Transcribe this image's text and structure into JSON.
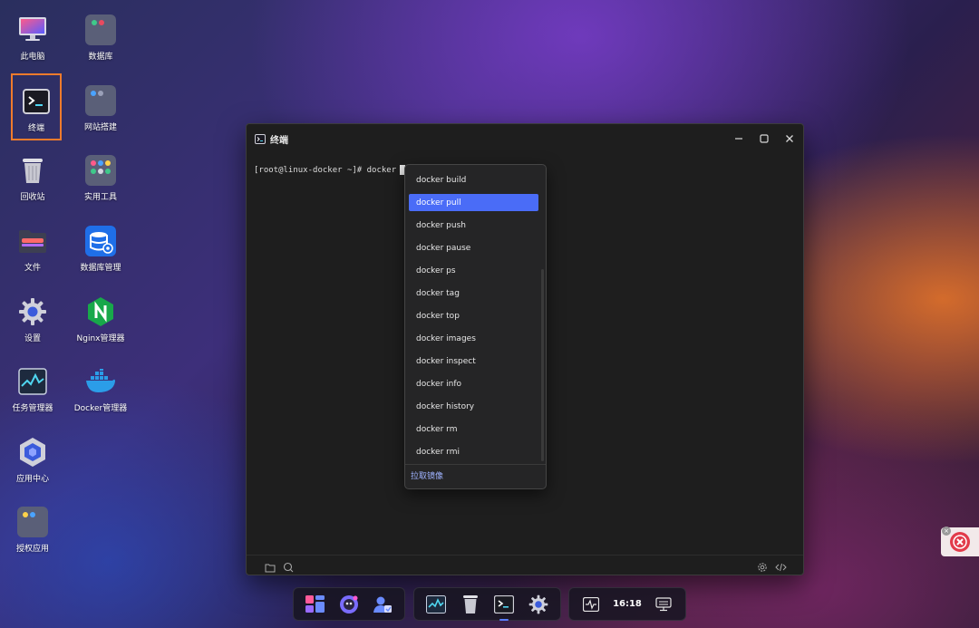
{
  "desktop": {
    "icons": [
      {
        "label": "此电脑"
      },
      {
        "label": "数据库"
      },
      {
        "label": "终端"
      },
      {
        "label": "网站搭建"
      },
      {
        "label": "回收站"
      },
      {
        "label": "实用工具"
      },
      {
        "label": "文件"
      },
      {
        "label": "数据库管理"
      },
      {
        "label": "设置"
      },
      {
        "label": "Nginx管理器"
      },
      {
        "label": "任务管理器"
      },
      {
        "label": "Docker管理器"
      },
      {
        "label": "应用中心"
      },
      {
        "label": "授权应用"
      }
    ],
    "selected_icon": "终端"
  },
  "window": {
    "title": "终端",
    "icon": "terminal-icon",
    "controls": [
      "minimize-icon",
      "maximize-icon",
      "close-icon"
    ],
    "terminal": {
      "prompt": "[root@linux-docker ~]# docker"
    },
    "statusbar": {
      "left": [
        "folder-icon",
        "search-icon"
      ],
      "right": [
        "gear-icon",
        "code-icon"
      ]
    }
  },
  "autocomplete": {
    "items": [
      "docker build",
      "docker pull",
      "docker push",
      "docker pause",
      "docker ps",
      "docker tag",
      "docker top",
      "docker images",
      "docker inspect",
      "docker info",
      "docker history",
      "docker rm",
      "docker rmi"
    ],
    "selected": "docker pull",
    "footer": "拉取镜像"
  },
  "taskbar": {
    "clock": "16:18",
    "active_app": "terminal"
  },
  "colors": {
    "accent": "#4a6cf7",
    "selection_border": "#f07b2c",
    "terminal_bg": "#1e1e1e"
  }
}
